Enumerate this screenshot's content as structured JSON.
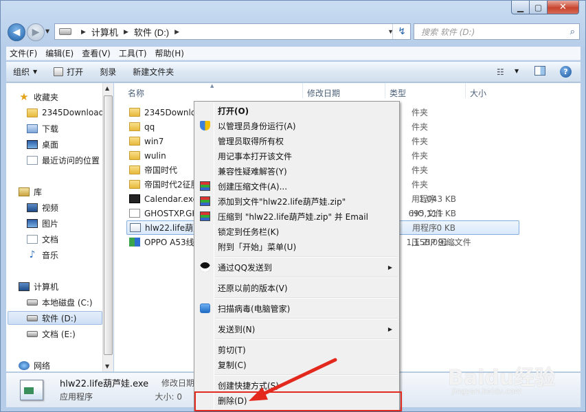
{
  "address": {
    "crumbs": [
      "计算机",
      "软件 (D:)"
    ]
  },
  "search": {
    "placeholder": "搜索 软件 (D:)"
  },
  "menubar": [
    "文件(F)",
    "编辑(E)",
    "查看(V)",
    "工具(T)",
    "帮助(H)"
  ],
  "toolbar": {
    "organize": "组织",
    "open": "打开",
    "burn": "刻录",
    "new_folder": "新建文件夹"
  },
  "nav": {
    "favorites": "收藏夹",
    "fav_items": [
      "2345Downloads",
      "下载",
      "桌面",
      "最近访问的位置"
    ],
    "libraries": "库",
    "lib_items": [
      "视频",
      "图片",
      "文档",
      "音乐"
    ],
    "computer": "计算机",
    "drives": [
      "本地磁盘 (C:)",
      "软件 (D:)",
      "文档 (E:)"
    ],
    "network": "网络"
  },
  "columns": {
    "name": "名称",
    "date": "修改日期",
    "type": "类型",
    "size": "大小"
  },
  "files": [
    {
      "name": "2345Downloads",
      "type": "件夹",
      "size": ""
    },
    {
      "name": "qq",
      "type": "件夹",
      "size": ""
    },
    {
      "name": "win7",
      "type": "件夹",
      "size": ""
    },
    {
      "name": "wulin",
      "type": "件夹",
      "size": ""
    },
    {
      "name": "帝国时代",
      "type": "件夹",
      "size": ""
    },
    {
      "name": "帝国时代2征服者",
      "type": "件夹",
      "size": ""
    },
    {
      "name": "Calendar.exe",
      "type": "用程序",
      "size": "1,043 KB"
    },
    {
      "name": "GHOSTXP.GHO",
      "type": "HO 文件",
      "size": "695,111 KB"
    },
    {
      "name": "hlw22.life葫芦娃.exe",
      "type": "用程序",
      "size": "0 KB"
    },
    {
      "name": "OPPO A53线刷包",
      "type": "压 ZIP 压缩文件",
      "size": "1,158,091..."
    }
  ],
  "details": {
    "name": "hlw22.life葫芦娃.exe",
    "type": "应用程序",
    "modified_label": "修改日期: 20",
    "size_label": "大小: 0"
  },
  "context_menu": {
    "open": "打开(O)",
    "run_admin": "以管理员身份运行(A)",
    "take_owner": "管理员取得所有权",
    "notepad": "用记事本打开该文件",
    "compat": "兼容性疑难解答(Y)",
    "create_archive": "创建压缩文件(A)...",
    "add_zip": "添加到文件\"hlw22.life葫芦娃.zip\"",
    "zip_email": "压缩到 \"hlw22.life葫芦娃.zip\" 并 Email",
    "pin_taskbar": "锁定到任务栏(K)",
    "pin_start": "附到「开始」菜单(U)",
    "send_qq": "通过QQ发送到",
    "restore": "还原以前的版本(V)",
    "scan": "扫描病毒(电脑管家)",
    "send_to": "发送到(N)",
    "cut": "剪切(T)",
    "copy": "复制(C)",
    "shortcut": "创建快捷方式(S)",
    "delete": "删除(D)"
  },
  "watermark": {
    "brand": "Baidu经验",
    "url": "jingyan.baidu.com"
  },
  "accent": {
    "highlight": "#e3281e",
    "selection": "#cce4f7"
  }
}
